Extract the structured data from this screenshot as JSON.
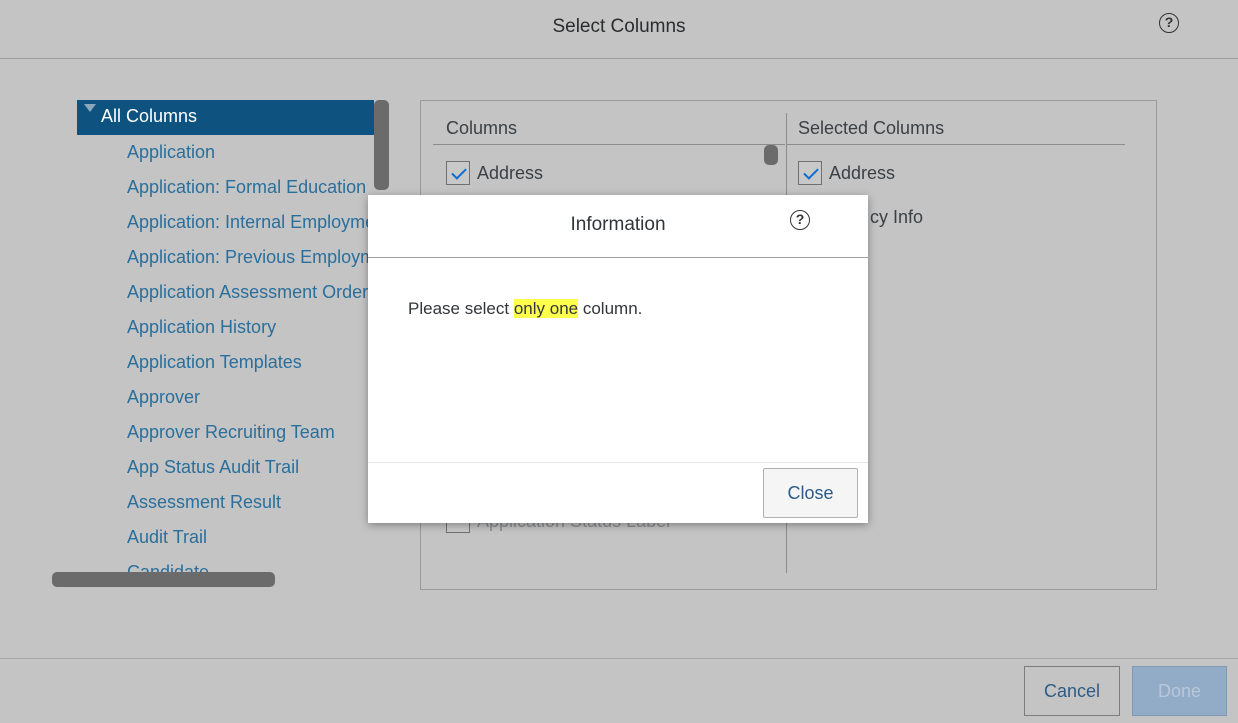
{
  "dialog": {
    "title": "Select Columns",
    "help_icon": "question-circle-icon"
  },
  "tree": {
    "root_label": "All Columns",
    "items": [
      "Application",
      "Application: Formal Education",
      "Application: Internal Employment",
      "Application: Previous Employment",
      "Application Assessment Order",
      "Application History",
      "Application Templates",
      "Approver",
      "Approver Recruiting Team",
      "App Status Audit Trail",
      "Assessment Result",
      "Audit Trail",
      "Candidate"
    ]
  },
  "columns": {
    "header": "Columns",
    "items": [
      {
        "label": "Address",
        "checked": true
      },
      {
        "label": "Application Status Label",
        "checked": false
      }
    ]
  },
  "selected": {
    "header": "Selected Columns",
    "items": [
      "Address",
      "cy Info"
    ]
  },
  "footer": {
    "cancel_label": "Cancel",
    "done_label": "Done"
  },
  "modal": {
    "title": "Information",
    "message_before": "Please select ",
    "message_highlight": "only one",
    "message_after": " column.",
    "close_label": "Close"
  },
  "colors": {
    "accent": "#0e5380",
    "link": "#2a6f9c",
    "highlight": "#ffff4d"
  }
}
